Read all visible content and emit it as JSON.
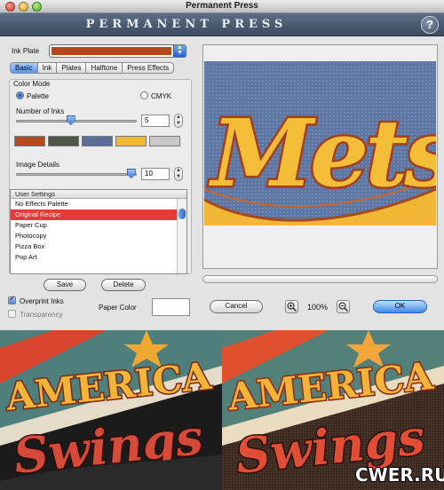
{
  "window": {
    "title": "Permanent Press",
    "banner": "PERMANENT PRESS",
    "help_glyph": "?"
  },
  "ink_plate": {
    "label": "Ink Plate",
    "color": "#b5471f"
  },
  "tabs": [
    {
      "label": "Basic",
      "active": true
    },
    {
      "label": "Ink",
      "active": false
    },
    {
      "label": "Plates",
      "active": false
    },
    {
      "label": "Halftone",
      "active": false
    },
    {
      "label": "Press Effects",
      "active": false
    }
  ],
  "color_mode": {
    "label": "Color Mode",
    "options": [
      {
        "label": "Palette",
        "selected": true
      },
      {
        "label": "CMYK",
        "selected": false
      }
    ]
  },
  "number_of_inks": {
    "label": "Number of Inks",
    "value": "5",
    "fraction": 0.45
  },
  "inks": [
    "#b44a1e",
    "#4e5747",
    "#5a6f98",
    "#f0b634",
    "#c8c8c8"
  ],
  "image_details": {
    "label": "Image Details",
    "value": "10",
    "fraction": 0.99
  },
  "user_settings": {
    "header": "User Settings",
    "items": [
      {
        "label": "No Effects Palette",
        "selected": false
      },
      {
        "label": "Original Recipe",
        "selected": true
      },
      {
        "label": "Paper Cup",
        "selected": false
      },
      {
        "label": "Photocopy",
        "selected": false
      },
      {
        "label": "Pizza Box",
        "selected": false
      },
      {
        "label": "Pop Art",
        "selected": false
      }
    ]
  },
  "buttons": {
    "save": "Save",
    "delete": "Delete",
    "cancel": "Cancel",
    "ok": "OK"
  },
  "overprint": {
    "label": "Overprint Inks",
    "checked": true
  },
  "transparency": {
    "label": "Transparency",
    "checked": false
  },
  "paper_color": {
    "label": "Paper Color",
    "value": "#ffffff"
  },
  "zoom": {
    "value": "100%",
    "in_icon": "zoom-in-icon",
    "out_icon": "zoom-out-icon"
  },
  "preview_art": {
    "text": "Mets"
  },
  "samples": [
    {
      "line1": "AMERICA",
      "line2": "Swings"
    },
    {
      "line1": "AMERICA",
      "line2": "Swings"
    }
  ],
  "watermark": "CWER.RU"
}
